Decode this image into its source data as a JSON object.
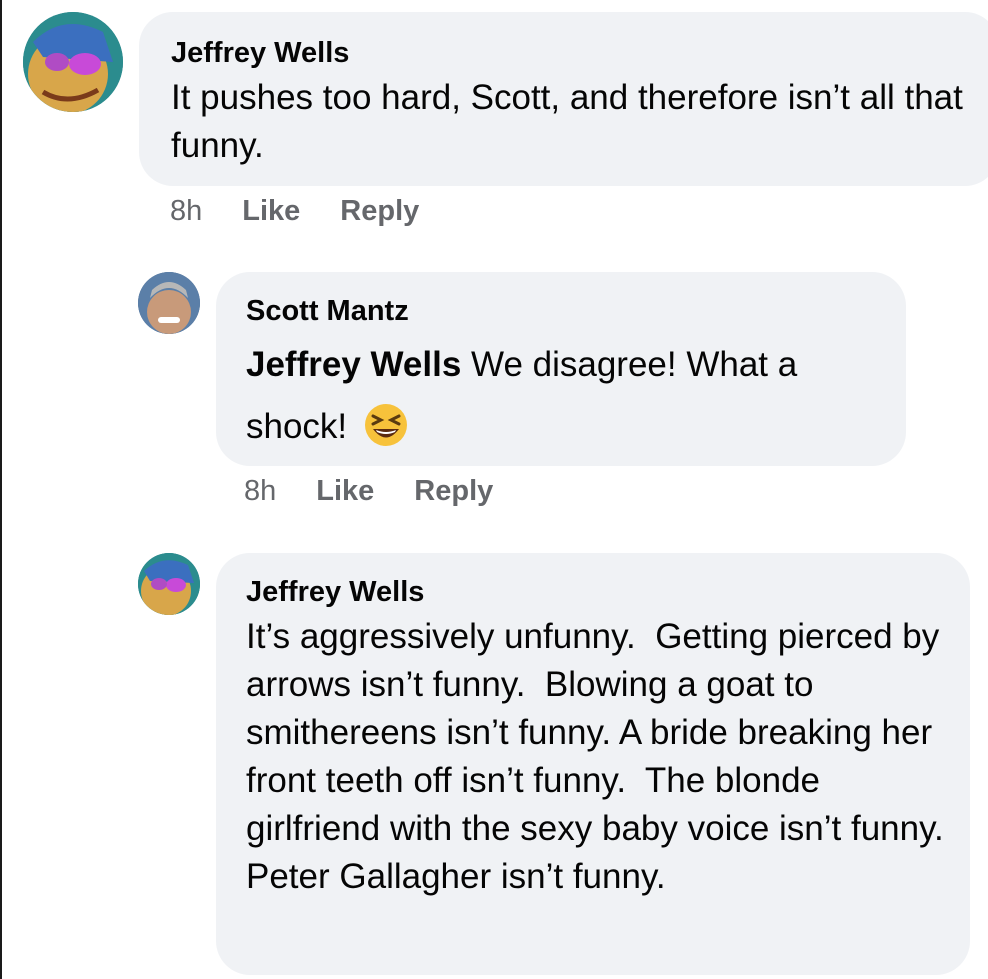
{
  "comments": [
    {
      "author": "Jeffrey Wells",
      "text": "It pushes too hard, Scott, and therefore isn’t all that funny.",
      "time": "8h",
      "like_label": "Like",
      "reply_label": "Reply"
    },
    {
      "author": "Scott Mantz",
      "mention": "Jeffrey Wells",
      "text": "We disagree! What a shock!",
      "emoji": "grinning-squinting-face",
      "time": "8h",
      "like_label": "Like",
      "reply_label": "Reply"
    },
    {
      "author": "Jeffrey Wells",
      "text": "It’s aggressively unfunny.  Getting pierced by arrows isn’t funny.  Blowing a goat to smithereens isn’t funny. A bride breaking her front teeth off isn’t funny.  The blonde girlfriend with the sexy baby voice isn’t funny.  Peter Gallagher isn’t funny."
    }
  ],
  "colors": {
    "bubble": "#f0f2f5",
    "meta_text": "#65676b",
    "text": "#050505",
    "emoji": "#f7c23b"
  }
}
